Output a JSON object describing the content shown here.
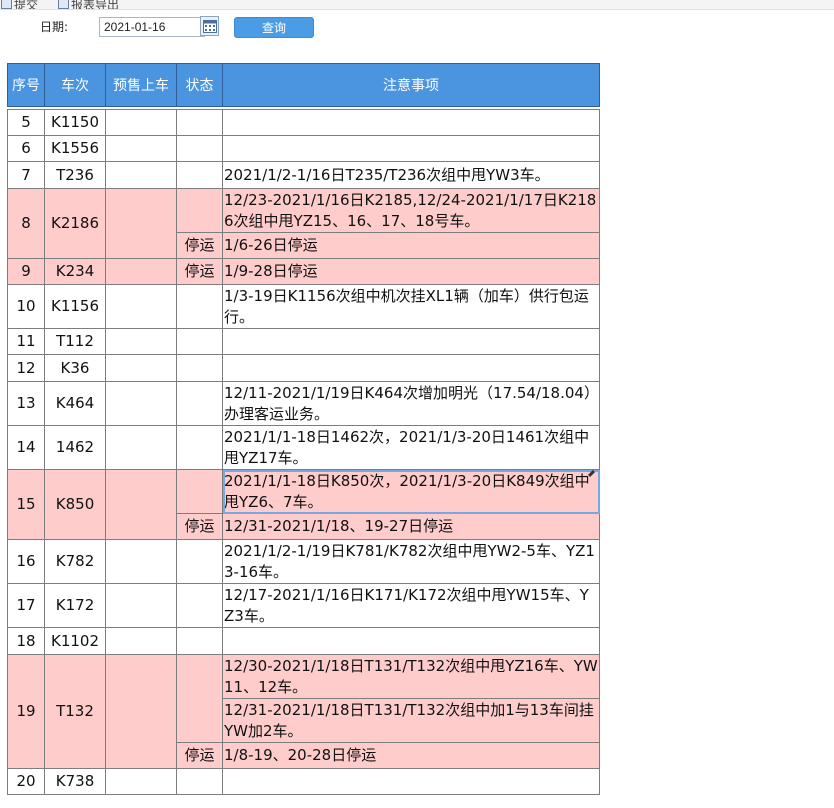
{
  "toolbar": {
    "top_items": [
      "提交",
      "报表导出"
    ],
    "date_label": "日期:",
    "date_value": "2021-01-16",
    "query_label": "查询"
  },
  "table": {
    "headers": [
      "序号",
      "车次",
      "预售上车",
      "状态",
      "注意事项"
    ],
    "highlight_color": "#ffcccc",
    "header_color": "#4a94e0",
    "rows": [
      {
        "no": "5",
        "train": "K1150",
        "presale": "",
        "status": "",
        "notes": ""
      },
      {
        "no": "6",
        "train": "K1556",
        "presale": "",
        "status": "",
        "notes": ""
      },
      {
        "no": "7",
        "train": "T236",
        "presale": "",
        "status": "",
        "notes": "2021/1/2-1/16日T235/T236次组中甩YW3车。"
      },
      {
        "no": "8",
        "train": "K2186",
        "presale": "",
        "status": "",
        "notes": "12/23-2021/1/16日K2185,12/24-2021/1/17日K2186次组中甩YZ15、16、17、18号车。"
      },
      {
        "no": "",
        "train": "",
        "presale": "",
        "status": "停运",
        "notes": "1/6-26日停运"
      },
      {
        "no": "9",
        "train": "K234",
        "presale": "",
        "status": "停运",
        "notes": "1/9-28日停运"
      },
      {
        "no": "10",
        "train": "K1156",
        "presale": "",
        "status": "",
        "notes": "1/3-19日K1156次组中机次挂XL1辆（加车）供行包运行。"
      },
      {
        "no": "11",
        "train": "T112",
        "presale": "",
        "status": "",
        "notes": ""
      },
      {
        "no": "12",
        "train": "K36",
        "presale": "",
        "status": "",
        "notes": ""
      },
      {
        "no": "13",
        "train": "K464",
        "presale": "",
        "status": "",
        "notes": "12/11-2021/1/19日K464次增加明光（17.54/18.04）办理客运业务。"
      },
      {
        "no": "14",
        "train": "1462",
        "presale": "",
        "status": "",
        "notes": "2021/1/1-18日1462次，2021/1/3-20日1461次组中甩YZ17车。"
      },
      {
        "no": "15",
        "train": "K850",
        "presale": "",
        "status": "",
        "notes": "2021/1/1-18日K850次，2021/1/3-20日K849次组中甩YZ6、7车。"
      },
      {
        "no": "",
        "train": "",
        "presale": "",
        "status": "停运",
        "notes": "12/31-2021/1/18、19-27日停运"
      },
      {
        "no": "16",
        "train": "K782",
        "presale": "",
        "status": "",
        "notes": "2021/1/2-1/19日K781/K782次组中甩YW2-5车、YZ13-16车。"
      },
      {
        "no": "17",
        "train": "K172",
        "presale": "",
        "status": "",
        "notes": "12/17-2021/1/16日K171/K172次组中甩YW15车、YZ3车。"
      },
      {
        "no": "18",
        "train": "K1102",
        "presale": "",
        "status": "",
        "notes": ""
      },
      {
        "no": "19",
        "train": "T132",
        "presale": "",
        "status": "",
        "notes": "12/30-2021/1/18日T131/T132次组中甩YZ16车、YW11、12车。"
      },
      {
        "no": "",
        "train": "",
        "presale": "",
        "status": "",
        "notes": "12/31-2021/1/18日T131/T132次组中加1与13车间挂YW加2车。"
      },
      {
        "no": "",
        "train": "",
        "presale": "",
        "status": "停运",
        "notes": "1/8-19、20-28日停运"
      },
      {
        "no": "20",
        "train": "K738",
        "presale": "",
        "status": "",
        "notes": ""
      }
    ]
  }
}
